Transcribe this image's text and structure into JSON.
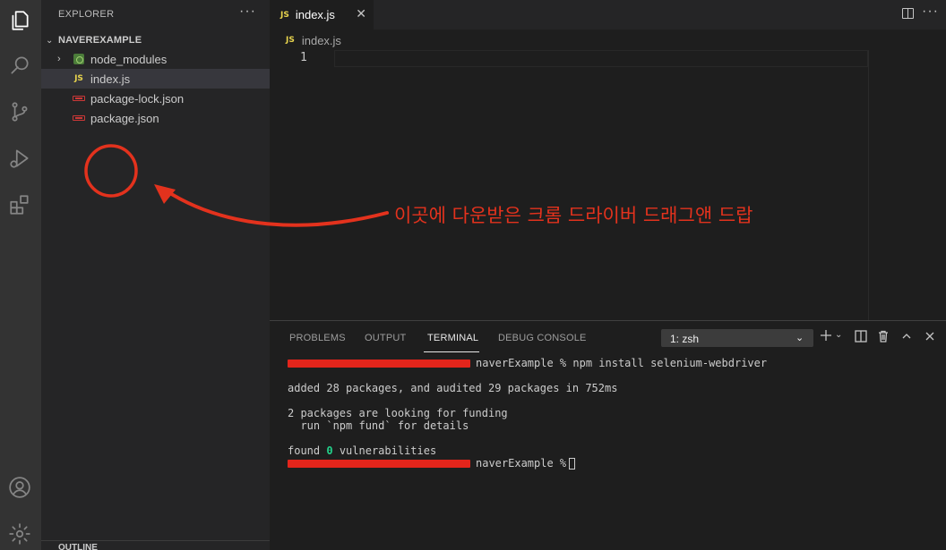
{
  "sidebar": {
    "title": "EXPLORER",
    "more": "···",
    "folder": "NAVEREXAMPLE",
    "items": [
      {
        "label": "node_modules",
        "icon": "node-folder-icon"
      },
      {
        "label": "index.js",
        "icon": "js-file-icon",
        "badge": "JS"
      },
      {
        "label": "package-lock.json",
        "icon": "json-file-icon"
      },
      {
        "label": "package.json",
        "icon": "json-file-icon"
      }
    ],
    "outline": "OUTLINE"
  },
  "editor": {
    "tab_label": "index.js",
    "tab_badge": "JS",
    "breadcrumb": "index.js",
    "line_number": "1"
  },
  "panel": {
    "tabs": [
      "PROBLEMS",
      "OUTPUT",
      "TERMINAL",
      "DEBUG CONSOLE"
    ],
    "active_tab": "TERMINAL",
    "terminal_select": "1: zsh",
    "terminal": {
      "line1_cmd": "naverExample % npm install selenium-webdriver",
      "line2": "added 28 packages, and audited 29 packages in 752ms",
      "line3": "2 packages are looking for funding",
      "line4": "  run `npm fund` for details",
      "line5_prefix": "found ",
      "line5_zero": "0",
      "line5_suffix": " vulnerabilities",
      "line6_prompt": "naverExample %"
    }
  },
  "annotation": {
    "text": "이곳에 다운받은 크롬 드라이버 드래그앤 드랍",
    "color": "#e3321d"
  },
  "colors": {
    "activity_bar": "#333333",
    "sidebar": "#252526",
    "editor": "#1e1e1e",
    "js_badge": "#e8d44d",
    "json_badge": "#cb3837",
    "terminal_success": "#23d18b"
  }
}
